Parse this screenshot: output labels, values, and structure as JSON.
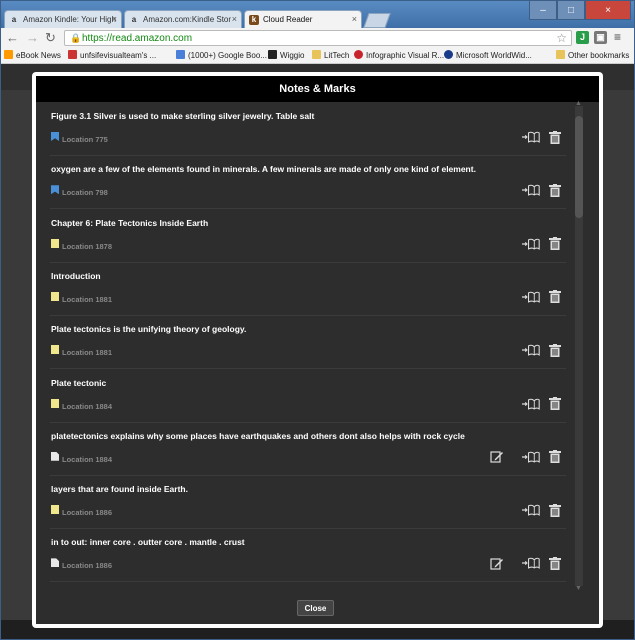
{
  "browser": {
    "tabs": [
      {
        "label": "Amazon Kindle: Your High",
        "favicon": "amazon-icon"
      },
      {
        "label": "Amazon.com:Kindle Stor",
        "favicon": "amazon-icon"
      },
      {
        "label": "Cloud Reader",
        "favicon": "kindle-icon"
      }
    ],
    "url": "https://read.amazon.com",
    "bookmarks": [
      {
        "label": "eBook News",
        "icon": "amazon-icon"
      },
      {
        "label": "unfsifevisualteam's ...",
        "icon": "puzzle-icon"
      },
      {
        "label": "(1000+) Google Boo...",
        "icon": "google-icon"
      },
      {
        "label": "Wiggio",
        "icon": "wiggio-icon"
      },
      {
        "label": "LitTech",
        "icon": "folder-icon"
      },
      {
        "label": "Infographic Visual R...",
        "icon": "pinterest-icon"
      },
      {
        "label": "Microsoft WorldWid...",
        "icon": "globe-icon"
      }
    ],
    "other_bookmarks": "Other bookmarks"
  },
  "modal": {
    "title": "Notes & Marks",
    "close_label": "Close",
    "items": [
      {
        "text": "Figure 3.1  Silver is used to make sterling silver jewelry. Table salt",
        "location": "Location 775",
        "type": "bookmark",
        "editable": false
      },
      {
        "text": "oxygen are a few of the elements found in minerals. A few minerals are made of only one kind of element.",
        "location": "Location 798",
        "type": "bookmark",
        "editable": false
      },
      {
        "text": "Chapter 6: Plate Tectonics Inside Earth",
        "location": "Location 1878",
        "type": "highlight",
        "editable": false
      },
      {
        "text": "Introduction",
        "location": "Location 1881",
        "type": "highlight",
        "editable": false
      },
      {
        "text": "Plate tectonics is the unifying theory of geology.",
        "location": "Location 1881",
        "type": "highlight",
        "editable": false
      },
      {
        "text": "Plate tectonic",
        "location": "Location 1884",
        "type": "highlight",
        "editable": false
      },
      {
        "text": "platetectonics explains why some places have earthquakes and others dont also helps with rock cycle",
        "location": "Location 1884",
        "type": "note",
        "editable": true
      },
      {
        "text": "layers that are found inside Earth.",
        "location": "Location 1886",
        "type": "highlight",
        "editable": false
      },
      {
        "text": "in to out: inner core . outter core . mantle . crust",
        "location": "Location 1886",
        "type": "note",
        "editable": true
      }
    ]
  },
  "colors": {
    "bookmark": "#4a90d9",
    "highlight": "#f0e68c",
    "modal_bg": "#2d2d2d",
    "header_bg": "#000000"
  }
}
